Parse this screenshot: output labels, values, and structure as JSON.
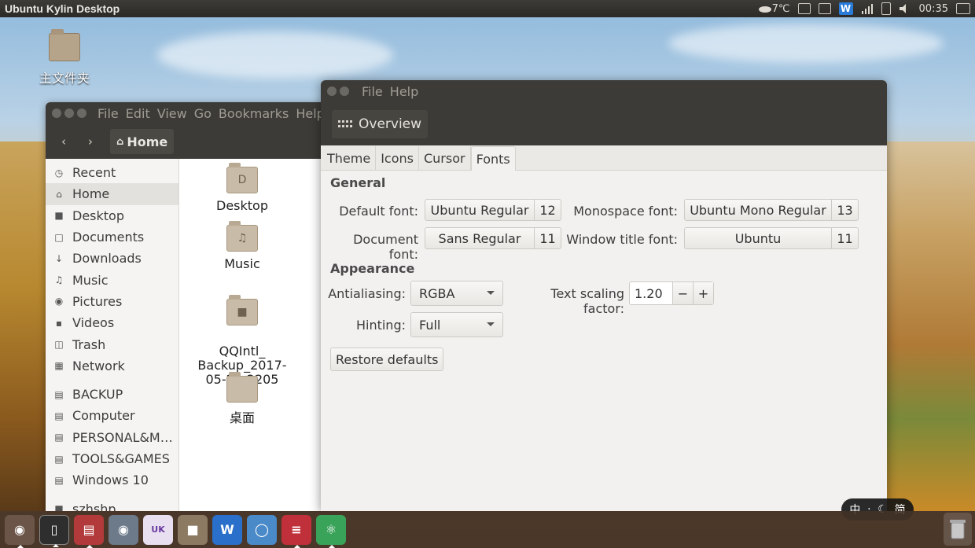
{
  "panel": {
    "title": "Ubuntu Kylin Desktop",
    "weather": "7℃",
    "clock": "00:35",
    "icons": [
      "weather-icon",
      "keyboard-icon",
      "calendar-icon",
      "wps-icon",
      "network-icon",
      "battery-icon",
      "volume-icon",
      "session-icon"
    ]
  },
  "desktop": {
    "home_folder_label": "主文件夹"
  },
  "file_manager": {
    "menu": [
      "File",
      "Edit",
      "View",
      "Go",
      "Bookmarks",
      "Help"
    ],
    "path": "Home",
    "sidebar": [
      {
        "label": "Recent",
        "icon": "clock-icon"
      },
      {
        "label": "Home",
        "icon": "home-icon"
      },
      {
        "label": "Desktop",
        "icon": "folder-icon"
      },
      {
        "label": "Documents",
        "icon": "document-icon"
      },
      {
        "label": "Downloads",
        "icon": "download-icon"
      },
      {
        "label": "Music",
        "icon": "music-icon"
      },
      {
        "label": "Pictures",
        "icon": "camera-icon"
      },
      {
        "label": "Videos",
        "icon": "video-icon"
      },
      {
        "label": "Trash",
        "icon": "trash-icon"
      },
      {
        "label": "Network",
        "icon": "network-icon"
      }
    ],
    "devices": [
      {
        "label": "BACKUP",
        "icon": "drive-icon"
      },
      {
        "label": "Computer",
        "icon": "drive-icon"
      },
      {
        "label": "PERSONAL&M…",
        "icon": "drive-icon"
      },
      {
        "label": "TOOLS&GAMES",
        "icon": "drive-icon"
      },
      {
        "label": "Windows 10",
        "icon": "drive-icon"
      }
    ],
    "bookmarks": [
      {
        "label": "szhshp",
        "icon": "folder-icon"
      }
    ],
    "files": [
      {
        "name": "Desktop",
        "icon": "desktop-folder-icon"
      },
      {
        "name": "Music",
        "icon": "music-folder-icon"
      },
      {
        "name": "QQIntl_\nBackup_2017-\n05-20-2205",
        "icon": "locked-folder-icon"
      },
      {
        "name": "桌面",
        "icon": "folder-icon"
      }
    ]
  },
  "tweak": {
    "menu": [
      "File",
      "Help"
    ],
    "overview_label": "Overview",
    "tabs": [
      "Theme",
      "Icons",
      "Cursor",
      "Fonts"
    ],
    "active_tab": "Fonts",
    "general": {
      "title": "General",
      "default_font_label": "Default font:",
      "default_font": "Ubuntu Regular",
      "default_size": "12",
      "mono_font_label": "Monospace font:",
      "mono_font": "Ubuntu Mono Regular",
      "mono_size": "13",
      "document_font_label": "Document font:",
      "document_font": "Sans Regular",
      "document_size": "11",
      "window_title_font_label": "Window title font:",
      "window_title_font": "Ubuntu",
      "window_title_size": "11"
    },
    "appearance": {
      "title": "Appearance",
      "antialiasing_label": "Antialiasing:",
      "antialiasing_value": "RGBA",
      "scaling_label": "Text scaling factor:",
      "scaling_value": "1.20",
      "minus": "−",
      "plus": "+",
      "hinting_label": "Hinting:",
      "hinting_value": "Full"
    },
    "restore_label": "Restore defaults"
  },
  "ime": {
    "lang": "中",
    "dot": "·",
    "mode": "简"
  },
  "launcher": {
    "items": [
      {
        "name": "launcher-dash-button",
        "color": "#6b5548"
      },
      {
        "name": "launcher-terminal-button",
        "color": "#2e2e2e"
      },
      {
        "name": "launcher-files-button",
        "color": "#b23a3a"
      },
      {
        "name": "launcher-screenshot-button",
        "color": "#6c7a8a"
      },
      {
        "name": "launcher-software-center-button",
        "color": "#e8e0f0"
      },
      {
        "name": "launcher-archive-button",
        "color": "#8c7a62"
      },
      {
        "name": "launcher-wps-writer-button",
        "color": "#2a6fc9"
      },
      {
        "name": "launcher-chromium-button",
        "color": "#4a8ac9"
      },
      {
        "name": "launcher-settings-button",
        "color": "#c0303a"
      },
      {
        "name": "launcher-atom-button",
        "color": "#3aa35a"
      }
    ]
  }
}
